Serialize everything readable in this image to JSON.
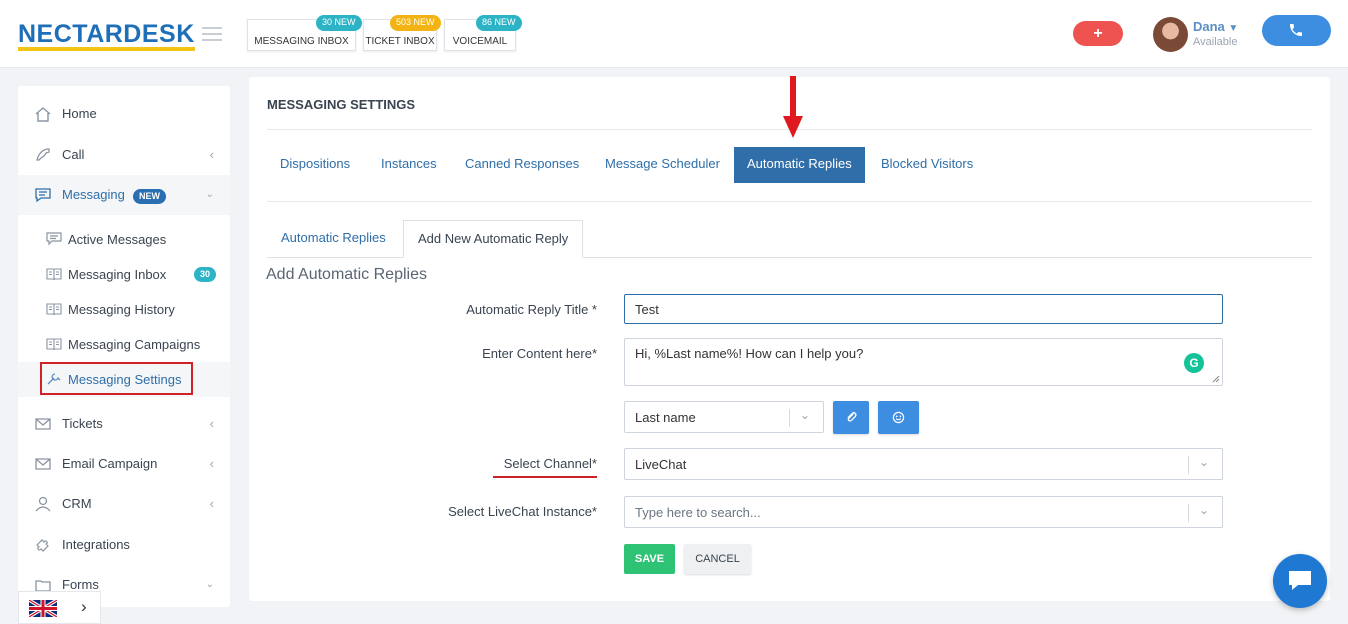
{
  "brand": {
    "name": "NECTARDESK"
  },
  "header": {
    "quick_buttons": [
      {
        "label": "MESSAGING INBOX",
        "badge": "30 NEW",
        "badge_color": "#2db3c6"
      },
      {
        "label": "TICKET INBOX",
        "badge": "503 NEW",
        "badge_color": "#f3b313"
      },
      {
        "label": "VOICEMAIL",
        "badge": "86 NEW",
        "badge_color": "#2db3c6"
      }
    ],
    "plus_label": "+",
    "user": {
      "name": "Dana",
      "status": "Available"
    }
  },
  "sidebar": {
    "items": [
      {
        "label": "Home"
      },
      {
        "label": "Call"
      },
      {
        "label": "Messaging",
        "badge": "NEW"
      },
      {
        "label": "Tickets"
      },
      {
        "label": "Email Campaign"
      },
      {
        "label": "CRM"
      },
      {
        "label": "Integrations"
      },
      {
        "label": "Forms"
      }
    ],
    "sub_items": [
      {
        "label": "Active Messages"
      },
      {
        "label": "Messaging Inbox",
        "badge": "30"
      },
      {
        "label": "Messaging History"
      },
      {
        "label": "Messaging Campaigns"
      },
      {
        "label": "Messaging Settings"
      }
    ]
  },
  "main": {
    "title": "MESSAGING SETTINGS",
    "tabs": [
      {
        "label": "Dispositions"
      },
      {
        "label": "Instances"
      },
      {
        "label": "Canned Responses"
      },
      {
        "label": "Message Scheduler"
      },
      {
        "label": "Automatic Replies"
      },
      {
        "label": "Blocked Visitors"
      }
    ],
    "subtabs": [
      {
        "label": "Automatic Replies"
      },
      {
        "label": "Add New Automatic Reply"
      }
    ],
    "form": {
      "heading": "Add Automatic Replies",
      "title_label": "Automatic Reply Title *",
      "title_value": "Test",
      "content_label": "Enter Content here*",
      "content_value": "Hi, %Last name%! How can I help you?",
      "variable_select": "Last name",
      "channel_label": "Select Channel*",
      "channel_value": "LiveChat",
      "instance_label": "Select LiveChat Instance*",
      "instance_placeholder": "Type here to search...",
      "save_label": "SAVE",
      "cancel_label": "CANCEL"
    }
  },
  "colors": {
    "accent": "#2f6ea8",
    "success": "#2ec275",
    "danger": "#ee5350",
    "highlight": "#d0202a"
  }
}
